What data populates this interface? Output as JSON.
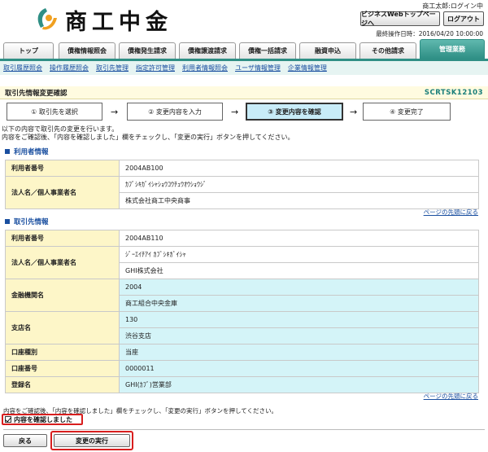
{
  "header": {
    "logo_text": "商工中金",
    "user_status": "商工太郎:ログイン中",
    "webtop_button": "ビジネスWebトップページへ",
    "logout_button": "ログアウト",
    "last_operation": "最終操作日時：2016/04/20 10:00:00"
  },
  "tabs": [
    "トップ",
    "債権情報照会",
    "債権発生請求",
    "債権譲渡請求",
    "債権一括請求",
    "融資申込",
    "その他請求",
    "管理業務"
  ],
  "subnav": [
    "取引履歴照会",
    "操作履歴照会",
    "取引先管理",
    "指定許可管理",
    "利用者情報照会",
    "ユーザ情報管理",
    "企業情報管理"
  ],
  "page": {
    "title": "取引先情報変更確認",
    "screen_code": "SCRTSK12103",
    "steps": [
      "① 取引先を選択",
      "② 変更内容を入力",
      "③ 変更内容を確認",
      "④ 変更完了"
    ],
    "arrow": "→",
    "instruction_1": "以下の内容で取引先の変更を行います。",
    "instruction_2": "内容をご確認後、「内容を確認しました」欄をチェックし、「変更の実行」ボタンを押してください。"
  },
  "user_info": {
    "heading": "利用者情報",
    "rows": [
      {
        "label": "利用者番号",
        "values": [
          "2004AB100"
        ]
      },
      {
        "label": "法人名／個人事業者名",
        "values": [
          "ｶﾌﾞｼｷｶﾞｲｼｬｼｮｳｺｳﾁｭｳｵｳｼｮｳｼﾞ",
          "株式会社商工中央商事"
        ]
      }
    ]
  },
  "partner_info": {
    "heading": "取引先情報",
    "rows": [
      {
        "label": "利用者番号",
        "values": [
          "2004AB110"
        ]
      },
      {
        "label": "法人名／個人事業者名",
        "values": [
          "ｼﾞｰｴｲﾁｱｲ ｶﾌﾞｼｷｶﾞｲｼｬ",
          "GHI株式会社"
        ]
      },
      {
        "label": "金融機関名",
        "values": [
          "2004",
          "商工組合中央金庫"
        ]
      },
      {
        "label": "支店名",
        "values": [
          "130",
          "渋谷支店"
        ]
      },
      {
        "label": "口座種別",
        "values": [
          "当座"
        ]
      },
      {
        "label": "口座番号",
        "values": [
          "0000011"
        ]
      },
      {
        "label": "登録名",
        "values": [
          "GHI(ｶﾌﾞ)営業部"
        ]
      }
    ]
  },
  "page_top_link": "ページの先頭に戻る",
  "bottom": {
    "note": "内容をご確認後、「内容を確認しました」欄をチェックし、「変更の実行」ボタンを押してください。",
    "confirm_label": "内容を確認しました",
    "confirm_checked": true,
    "back_button": "戻る",
    "execute_button": "変更の実行"
  },
  "colors": {
    "accent": "#2f8f85",
    "highlight": "#d81e1e",
    "link": "#1a4fa0",
    "label_bg": "#fdf6c8",
    "value_highlight_bg": "#d4f4f8"
  }
}
